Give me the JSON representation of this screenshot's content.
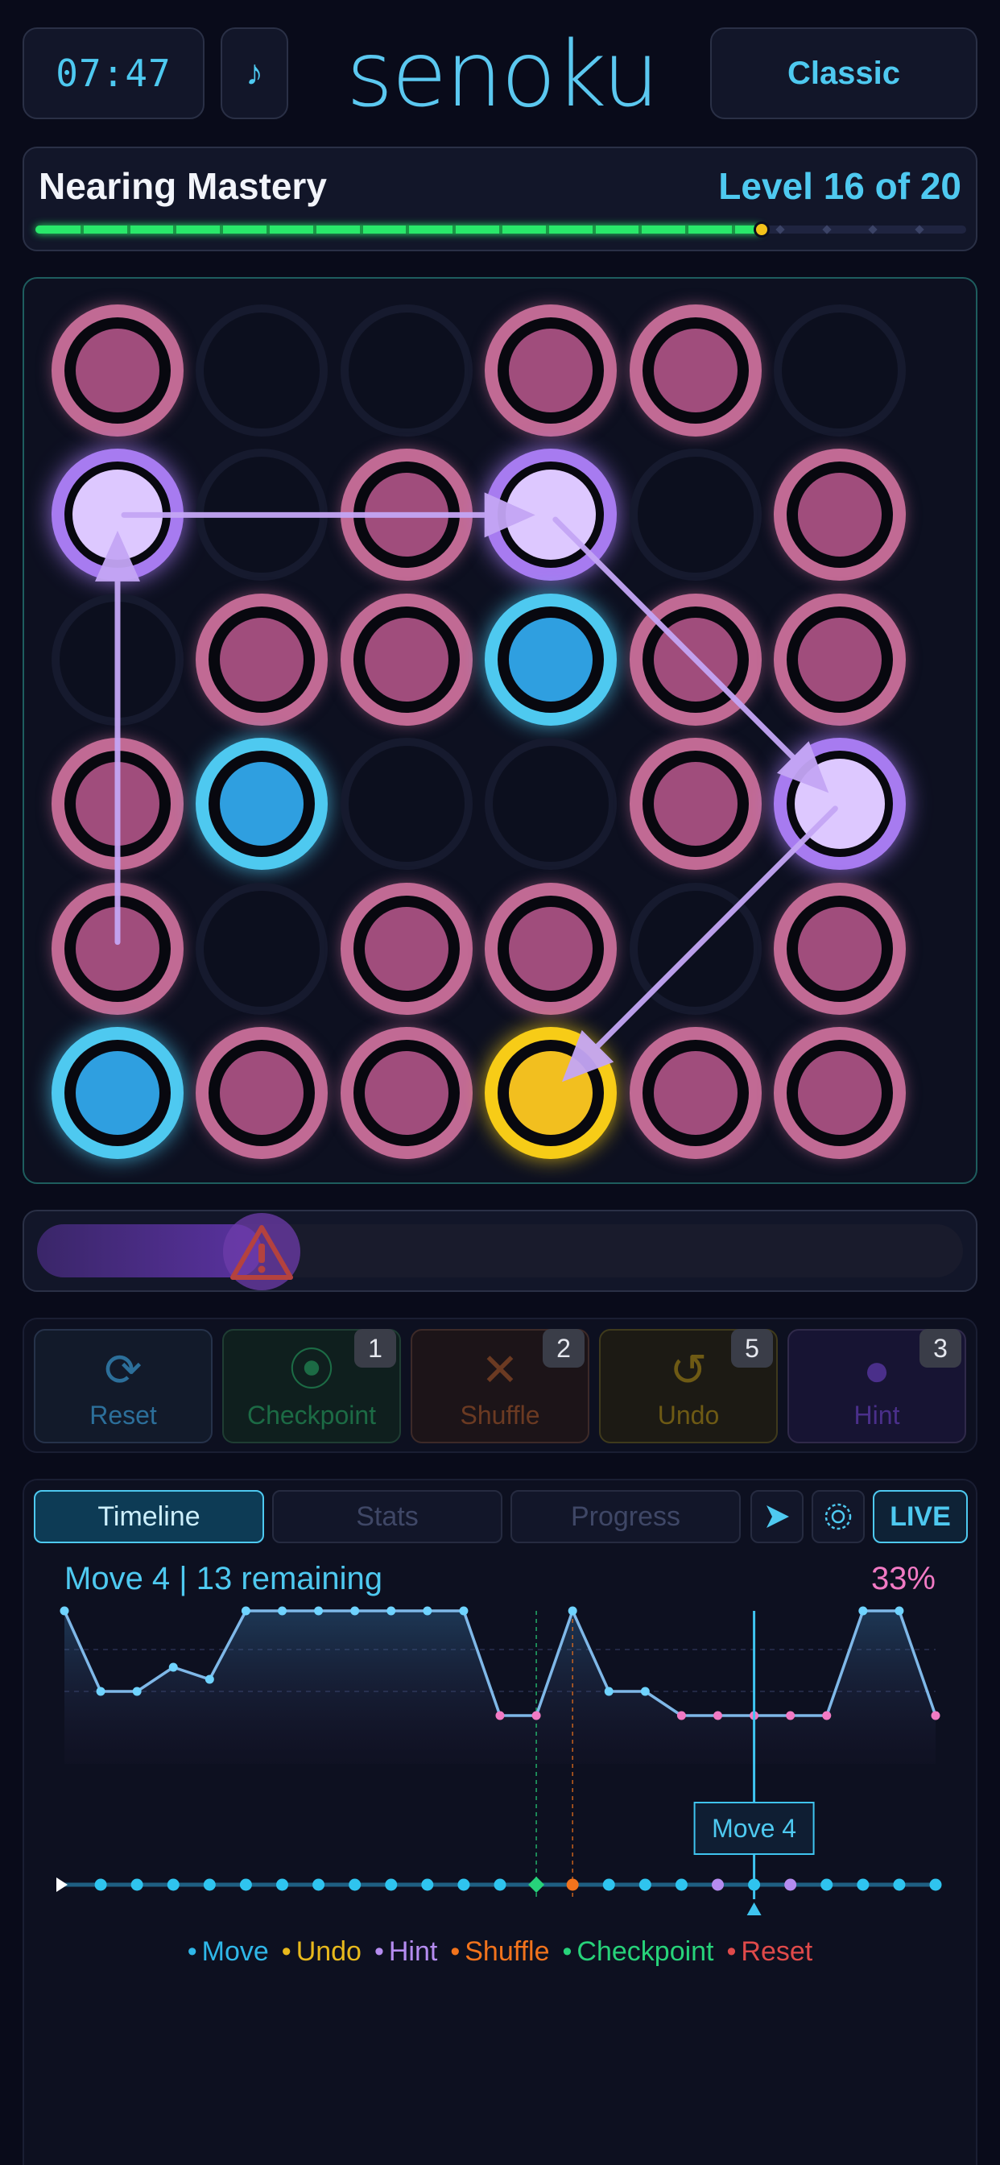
{
  "header": {
    "timer": "07:47",
    "music_icon": "music-note-icon",
    "music_glyph": "♪",
    "app_title": "senoku",
    "mode": "Classic"
  },
  "level": {
    "name": "Nearing Mastery",
    "label": "Level 16 of 20",
    "current": 16,
    "total": 20
  },
  "board": {
    "rows": 6,
    "cols": 6,
    "grid": [
      [
        "pink",
        "empty",
        "empty",
        "pink",
        "pink",
        "empty"
      ],
      [
        "path",
        "empty",
        "pink",
        "path",
        "empty",
        "pink"
      ],
      [
        "empty",
        "pink",
        "pink",
        "blue",
        "pink",
        "pink"
      ],
      [
        "pink",
        "blue",
        "empty",
        "empty",
        "pink",
        "path"
      ],
      [
        "pink",
        "empty",
        "pink",
        "pink",
        "empty",
        "pink"
      ],
      [
        "blue",
        "pink",
        "pink",
        "yellow",
        "pink",
        "pink"
      ]
    ],
    "path": [
      [
        4,
        0
      ],
      [
        1,
        0
      ],
      [
        1,
        3
      ],
      [
        3,
        5
      ],
      [
        5,
        3
      ]
    ]
  },
  "danger": {
    "level": 0.19,
    "icon": "warning-triangle-icon"
  },
  "powerups": [
    {
      "name": "reset",
      "label": "Reset",
      "icon": "refresh-icon",
      "glyph": "⟳",
      "count": null,
      "color": "#2c6f9a",
      "border": "#26324a",
      "bg": "#121a2a"
    },
    {
      "name": "checkpoint",
      "label": "Checkpoint",
      "icon": "map-pin-check-icon",
      "glyph": "⦿",
      "count": "1",
      "color": "#1c6b45",
      "border": "#1f3d33",
      "bg": "#0f1f1e"
    },
    {
      "name": "shuffle",
      "label": "Shuffle",
      "icon": "shuffle-arrows-icon",
      "glyph": "✕",
      "count": "2",
      "color": "#6b3a22",
      "border": "#3d2a28",
      "bg": "#1c1418"
    },
    {
      "name": "undo",
      "label": "Undo",
      "icon": "undo-arrow-icon",
      "glyph": "↺",
      "count": "5",
      "color": "#6e5a14",
      "border": "#3f3a1c",
      "bg": "#1c1a14"
    },
    {
      "name": "hint",
      "label": "Hint",
      "icon": "lightbulb-icon",
      "glyph": "●",
      "count": "3",
      "color": "#4a2f8a",
      "border": "#302a4a",
      "bg": "#171433"
    }
  ],
  "timeline": {
    "tabs": [
      "Timeline",
      "Stats",
      "Progress"
    ],
    "active_tab": "Timeline",
    "play_icon": "play-icon",
    "settings_icon": "target-settings-icon",
    "live_label": "LIVE",
    "status": "Move 4  |  13 remaining",
    "percent": "33%",
    "cursor_label": "Move 4",
    "legend": [
      {
        "label": "Move",
        "color": "#2fb7e8"
      },
      {
        "label": "Undo",
        "color": "#e8b91c"
      },
      {
        "label": "Hint",
        "color": "#b58cf0"
      },
      {
        "label": "Shuffle",
        "color": "#f2731c"
      },
      {
        "label": "Checkpoint",
        "color": "#27d37a"
      },
      {
        "label": "Reset",
        "color": "#e04a4a"
      }
    ]
  },
  "chart_data": {
    "type": "line",
    "series": [
      {
        "values": [
          3,
          1,
          1,
          1.6,
          1.3,
          3,
          3,
          3,
          3,
          3,
          3,
          3,
          0.4,
          0.4,
          3,
          1,
          1,
          0.4,
          0.4,
          0.4,
          0.4,
          0.4,
          3,
          3,
          0.4
        ]
      }
    ],
    "ylim": [
      0,
      3
    ],
    "events": [
      {
        "index": 13,
        "type": "Checkpoint"
      },
      {
        "index": 14,
        "type": "Shuffle"
      },
      {
        "index": 18,
        "type": "Hint"
      },
      {
        "index": 20,
        "type": "Hint"
      }
    ],
    "cursor_index": 19
  }
}
